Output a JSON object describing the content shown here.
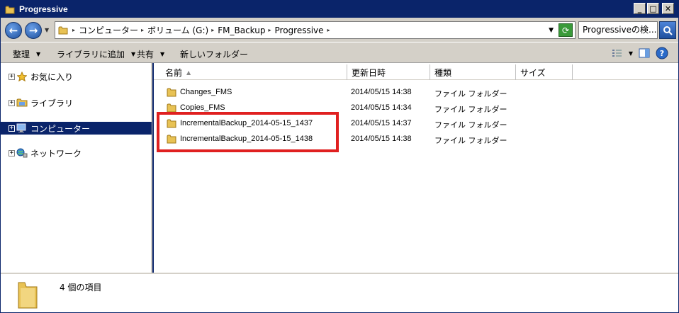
{
  "window": {
    "title": "Progressive"
  },
  "title_buttons": {
    "minimize": "_",
    "maximize": "□",
    "close": "✕"
  },
  "address": {
    "crumbs": [
      "コンピューター",
      "ボリューム (G:)",
      "FM_Backup",
      "Progressive"
    ],
    "search_placeholder": "Progressiveの検..."
  },
  "toolbar": {
    "organize": "整理",
    "add_to_library": "ライブラリに追加",
    "share": "共有",
    "new_folder": "新しいフォルダー"
  },
  "nav": {
    "items": [
      {
        "label": "お気に入り",
        "icon": "star-icon"
      },
      {
        "label": "ライブラリ",
        "icon": "library-icon"
      },
      {
        "label": "コンピューター",
        "icon": "computer-icon"
      },
      {
        "label": "ネットワーク",
        "icon": "network-icon"
      }
    ]
  },
  "columns": {
    "name": "名前",
    "date": "更新日時",
    "type": "種類",
    "size": "サイズ"
  },
  "files": [
    {
      "name": "Changes_FMS",
      "date": "2014/05/15 14:38",
      "type": "ファイル フォルダー"
    },
    {
      "name": "Copies_FMS",
      "date": "2014/05/15 14:34",
      "type": "ファイル フォルダー"
    },
    {
      "name": "IncrementalBackup_2014-05-15_1437",
      "date": "2014/05/15 14:37",
      "type": "ファイル フォルダー"
    },
    {
      "name": "IncrementalBackup_2014-05-15_1438",
      "date": "2014/05/15 14:38",
      "type": "ファイル フォルダー"
    }
  ],
  "status": {
    "item_count": "4 個の項目"
  },
  "colors": {
    "titlebar": "#0a246a",
    "chrome": "#d4d0c8",
    "highlight": "#e02020",
    "folder": "#e8c254"
  }
}
